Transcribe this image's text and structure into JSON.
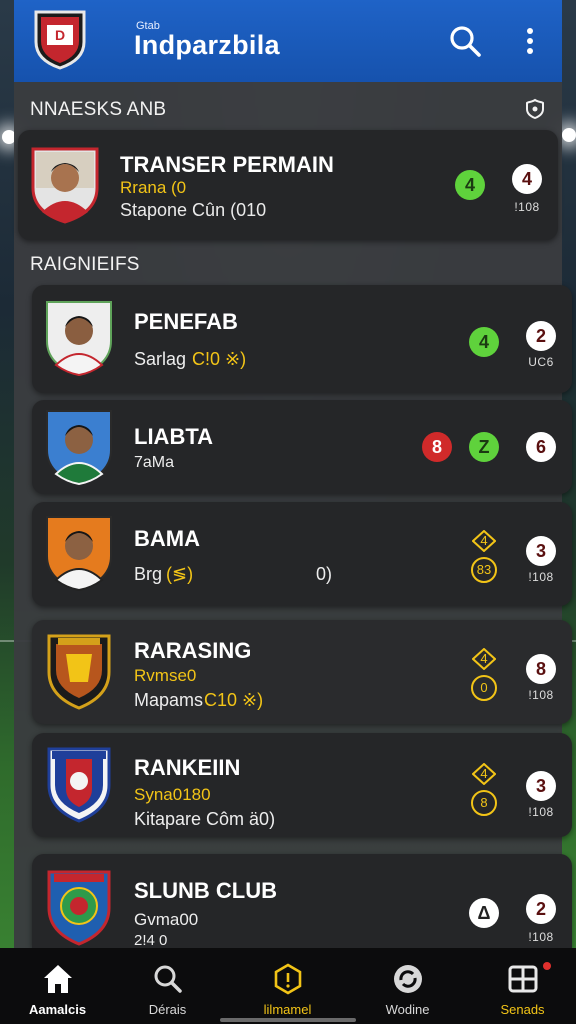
{
  "header": {
    "subtitle": "Gtab",
    "title": "Indparzbila"
  },
  "sections": {
    "first": "NNAESKS ANB",
    "second": "RAIGNIEIFS"
  },
  "cards": [
    {
      "name": "TRANSER PERMAIN",
      "line1": "Rrana (0",
      "line2": "Stapone Cûn (010",
      "badges": [
        "4"
      ],
      "score": "4",
      "score_sub": "!108"
    },
    {
      "name": "PENEFAB",
      "line2_a": "Sarlag",
      "line2_b": "C!0 ※)",
      "badges": [
        "4"
      ],
      "score": "2",
      "score_sub": "UC6"
    },
    {
      "name": "LIABTA",
      "line2": "7aMa",
      "badges": [
        "8",
        "Z"
      ],
      "score": "6",
      "score_sub": ""
    },
    {
      "name": "BAMA",
      "line2_a": "Brg",
      "line2_b": "(≶)",
      "line2_c": "0)",
      "trend_top": "4",
      "trend_bottom": "83",
      "score": "3",
      "score_sub": "!108"
    },
    {
      "name": "RARASING",
      "line1": "Rvmse0",
      "line2_a": "Mapams",
      "line2_b": "C10 ※)",
      "trend_top": "4",
      "trend_bottom": "0",
      "score": "8",
      "score_sub": "!108"
    },
    {
      "name": "RANKEIIN",
      "line1": "Syna0180",
      "line2": "Kitapare Côm ä0)",
      "trend_top": "4",
      "trend_bottom": "8",
      "score": "3",
      "score_sub": "!108"
    },
    {
      "name": "SLUNB CLUB",
      "line1": "Gvma00",
      "line2": "2!4 0",
      "badges": [
        "Δ"
      ],
      "score": "2",
      "score_sub": "!108"
    }
  ],
  "nav": [
    {
      "label": "Aamalcis",
      "icon": "home-icon",
      "color": "#ffffff"
    },
    {
      "label": "Dérais",
      "icon": "search-icon",
      "color": "#d8d8d8"
    },
    {
      "label": "lilmamel",
      "icon": "hexagon-info-icon",
      "color": "#f2c417"
    },
    {
      "label": "Wodine",
      "icon": "refresh-icon",
      "color": "#d8d8d8"
    },
    {
      "label": "Senads",
      "icon": "grid-icon",
      "color": "#f2c417"
    }
  ],
  "colors": {
    "header_blue": "#1a5bbd",
    "accent_yellow": "#f2c417",
    "badge_green": "#5fd23c",
    "badge_red": "#d02a2a"
  }
}
